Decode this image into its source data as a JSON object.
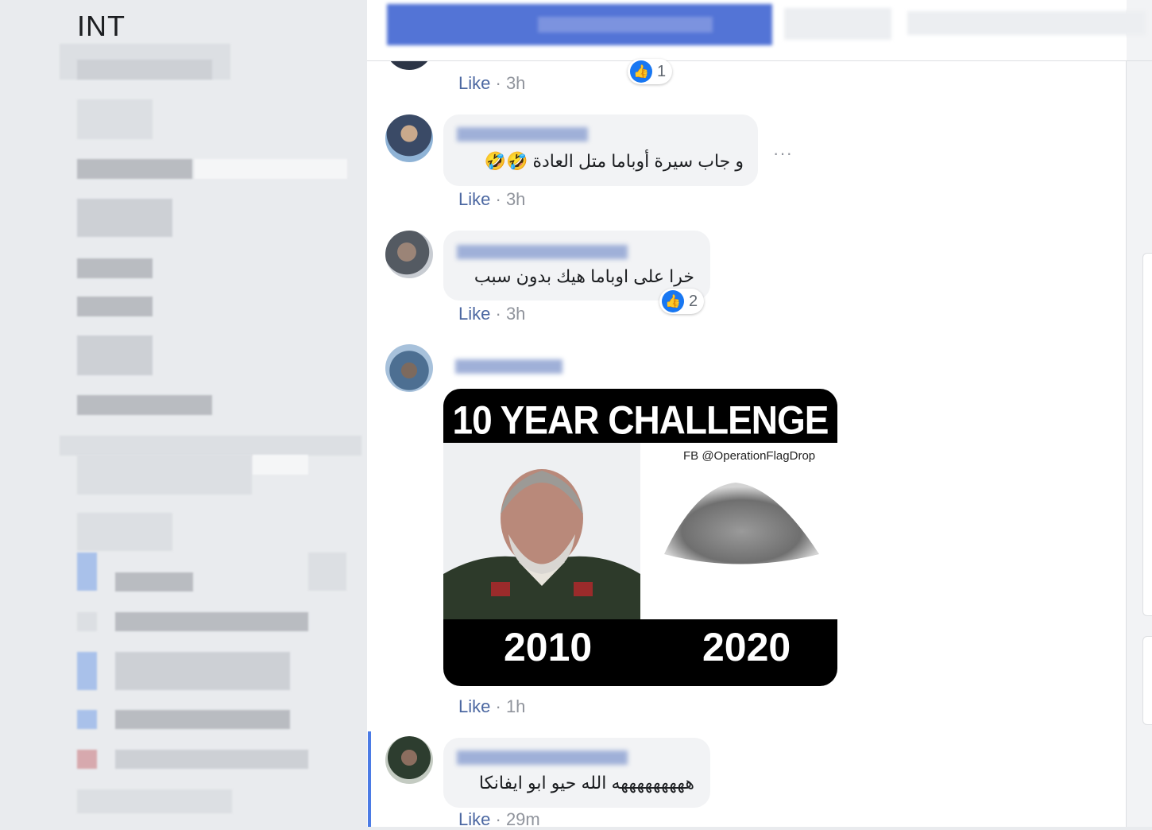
{
  "sidebar": {
    "title": "INT"
  },
  "comments": [
    {
      "time_label": "Like",
      "separator": "·",
      "time": "3h",
      "reactions": "1"
    },
    {
      "text": "و جاب سيرة أوباما متل العادة 🤣🤣",
      "time_label": "Like",
      "separator": "·",
      "time": "3h",
      "more": "···"
    },
    {
      "text": "خرا على اوباما هيك بدون سبب",
      "time_label": "Like",
      "separator": "·",
      "time": "3h",
      "reactions": "2"
    },
    {
      "meme": {
        "title": "10 YEAR CHALLENGE",
        "credit": "FB @OperationFlagDrop",
        "year_left": "2010",
        "year_right": "2020"
      },
      "time_label": "Like",
      "separator": "·",
      "time": "1h"
    },
    {
      "text": "هههههههههه الله حيو ابو ايفانكا",
      "time_label": "Like",
      "separator": "·",
      "time": "29m"
    }
  ],
  "colors": {
    "link_blue": "#4b67a1",
    "like_blue": "#1877f2",
    "bubble_grey": "#f2f3f5",
    "meta_grey": "#90949c"
  },
  "icons": [
    "thumbs-up-icon",
    "more-options-icon"
  ]
}
